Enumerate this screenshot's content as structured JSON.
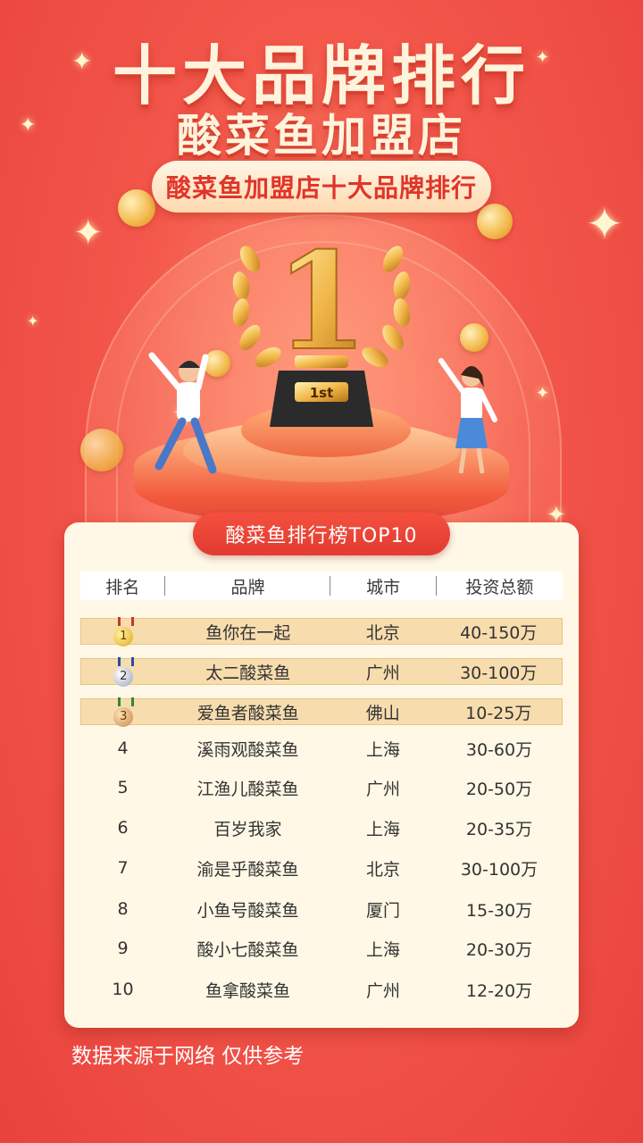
{
  "header": {
    "title_main": "十大品牌排行",
    "title_sub": "酸菜鱼加盟店",
    "pill_text": "酸菜鱼加盟店十大品牌排行"
  },
  "trophy": {
    "number": "1",
    "plaque": "1st"
  },
  "ranking": {
    "tab_label": "酸菜鱼排行榜TOP10",
    "columns": [
      "排名",
      "品牌",
      "城市",
      "投资总额"
    ],
    "rows": [
      {
        "rank": "1",
        "brand": "鱼你在一起",
        "city": "北京",
        "investment": "40-150万"
      },
      {
        "rank": "2",
        "brand": "太二酸菜鱼",
        "city": "广州",
        "investment": "30-100万"
      },
      {
        "rank": "3",
        "brand": "爱鱼者酸菜鱼",
        "city": "佛山",
        "investment": "10-25万"
      },
      {
        "rank": "4",
        "brand": "溪雨观酸菜鱼",
        "city": "上海",
        "investment": "30-60万"
      },
      {
        "rank": "5",
        "brand": "江渔儿酸菜鱼",
        "city": "广州",
        "investment": "20-50万"
      },
      {
        "rank": "6",
        "brand": "百岁我家",
        "city": "上海",
        "investment": "20-35万"
      },
      {
        "rank": "7",
        "brand": "渝是乎酸菜鱼",
        "city": "北京",
        "investment": "30-100万"
      },
      {
        "rank": "8",
        "brand": "小鱼号酸菜鱼",
        "city": "厦门",
        "investment": "15-30万"
      },
      {
        "rank": "9",
        "brand": "酸小七酸菜鱼",
        "city": "上海",
        "investment": "20-30万"
      },
      {
        "rank": "10",
        "brand": "鱼拿酸菜鱼",
        "city": "广州",
        "investment": "12-20万"
      }
    ]
  },
  "footer": {
    "note": "数据来源于网络 仅供参考"
  },
  "colors": {
    "primary_red": "#e8433d",
    "card_bg": "#fff8e6",
    "highlight_row": "#f7dcae",
    "gold": "#f2b84a"
  },
  "icons": [
    "gold-medal-icon",
    "silver-medal-icon",
    "bronze-medal-icon",
    "trophy-icon",
    "laurel-icon",
    "sparkle-icon",
    "coin-icon"
  ]
}
